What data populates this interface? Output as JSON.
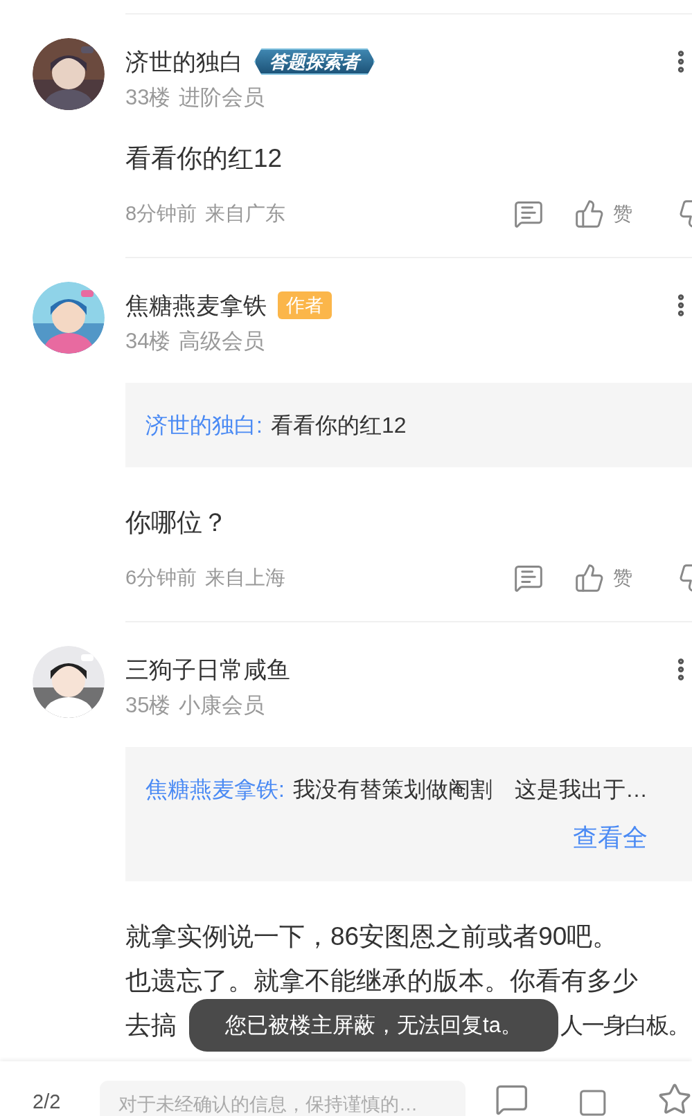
{
  "comments": [
    {
      "avatar": {
        "kind": "picture"
      },
      "name": "济世的独白",
      "badge": {
        "kind": "achievement",
        "text": "答题探索者"
      },
      "floor": "33楼",
      "level": "进阶会员",
      "body": [
        {
          "kind": "plain",
          "text": "看看你的红12"
        }
      ],
      "time": "8分钟前",
      "location": "来自广东",
      "like_label": "赞"
    },
    {
      "avatar": {
        "kind": "picture"
      },
      "name": "焦糖燕麦拿铁",
      "badge": {
        "kind": "author",
        "text": "作者"
      },
      "floor": "34楼",
      "level": "高级会员",
      "quote": {
        "author": "济世的独白:",
        "text": "看看你的红12"
      },
      "body": [
        {
          "kind": "plain",
          "text": "你哪位？"
        }
      ],
      "time": "6分钟前",
      "location": "来自上海",
      "like_label": "赞"
    },
    {
      "avatar": {
        "kind": "picture"
      },
      "name": "三狗子日常咸鱼",
      "floor": "35楼",
      "level": "小康会员",
      "quote": {
        "author": "焦糖燕麦拿铁:",
        "text": "我没有替策划做阉割　这是我出于…",
        "more": "查看全"
      },
      "body": [
        {
          "kind": "plain",
          "text": "就拿实例说一下，86安图恩之前或者90吧。"
        },
        {
          "kind": "plain",
          "text": "也遗忘了。就拿不能继承的版本。你看有多少"
        },
        {
          "kind": "split",
          "parts": [
            "去搞",
            "人一身白板。"
          ]
        }
      ]
    }
  ],
  "toast": "您已被楼主屏蔽，无法回复ta。",
  "bottom_bar": {
    "page": "2/2",
    "placeholder": "对于未经确认的信息，保持谨慎的…"
  }
}
